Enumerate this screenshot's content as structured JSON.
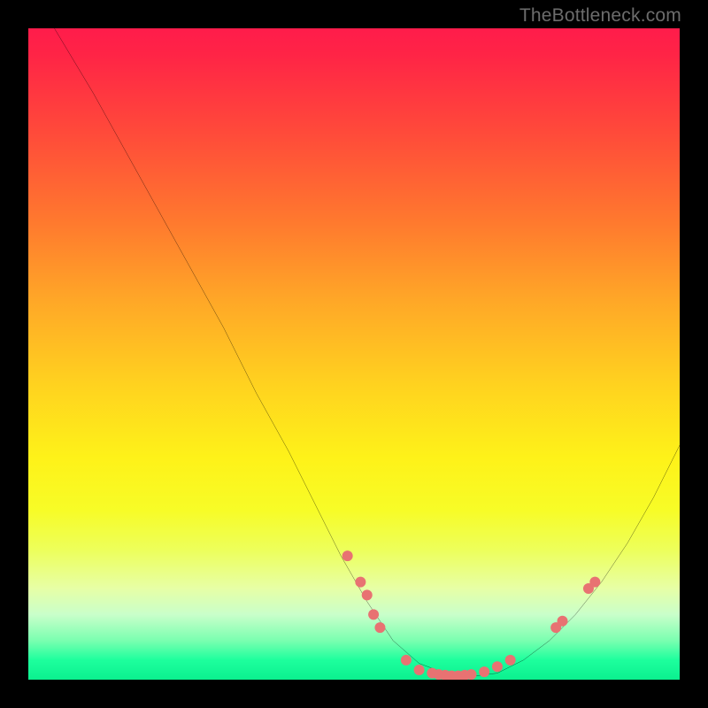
{
  "attribution": "TheBottleneck.com",
  "chart_data": {
    "type": "line",
    "title": "",
    "xlabel": "",
    "ylabel": "",
    "xlim": [
      0,
      100
    ],
    "ylim": [
      0,
      100
    ],
    "gradient_stops": [
      {
        "pos": 0,
        "color": "#ff1c4b"
      },
      {
        "pos": 16,
        "color": "#ff4a3a"
      },
      {
        "pos": 30,
        "color": "#ff7a2e"
      },
      {
        "pos": 42,
        "color": "#ffa827"
      },
      {
        "pos": 55,
        "color": "#ffd31f"
      },
      {
        "pos": 66,
        "color": "#fef219"
      },
      {
        "pos": 80,
        "color": "#edff5a"
      },
      {
        "pos": 90,
        "color": "#c9ffca"
      },
      {
        "pos": 100,
        "color": "#0bf08f"
      }
    ],
    "series": [
      {
        "name": "bottleneck-curve",
        "color": "#000000",
        "x": [
          4,
          7,
          10,
          15,
          20,
          25,
          30,
          35,
          40,
          45,
          48,
          52,
          56,
          60,
          64,
          68,
          72,
          76,
          80,
          84,
          88,
          92,
          96,
          100
        ],
        "y": [
          100,
          95,
          90,
          81,
          72,
          63,
          54,
          44,
          35,
          25,
          19,
          12,
          6,
          2.5,
          1,
          0.5,
          1,
          3,
          6,
          10,
          15,
          21,
          28,
          36
        ]
      }
    ],
    "markers": {
      "name": "highlight-points",
      "color": "#e87272",
      "radius": 6,
      "points": [
        {
          "x": 49,
          "y": 19
        },
        {
          "x": 51,
          "y": 15
        },
        {
          "x": 52,
          "y": 13
        },
        {
          "x": 53,
          "y": 10
        },
        {
          "x": 54,
          "y": 8
        },
        {
          "x": 58,
          "y": 3
        },
        {
          "x": 60,
          "y": 1.5
        },
        {
          "x": 62,
          "y": 1
        },
        {
          "x": 63,
          "y": 0.8
        },
        {
          "x": 64,
          "y": 0.7
        },
        {
          "x": 65,
          "y": 0.6
        },
        {
          "x": 66,
          "y": 0.6
        },
        {
          "x": 67,
          "y": 0.7
        },
        {
          "x": 68,
          "y": 0.8
        },
        {
          "x": 70,
          "y": 1.2
        },
        {
          "x": 72,
          "y": 2
        },
        {
          "x": 74,
          "y": 3
        },
        {
          "x": 81,
          "y": 8
        },
        {
          "x": 82,
          "y": 9
        },
        {
          "x": 86,
          "y": 14
        },
        {
          "x": 87,
          "y": 15
        }
      ]
    }
  }
}
